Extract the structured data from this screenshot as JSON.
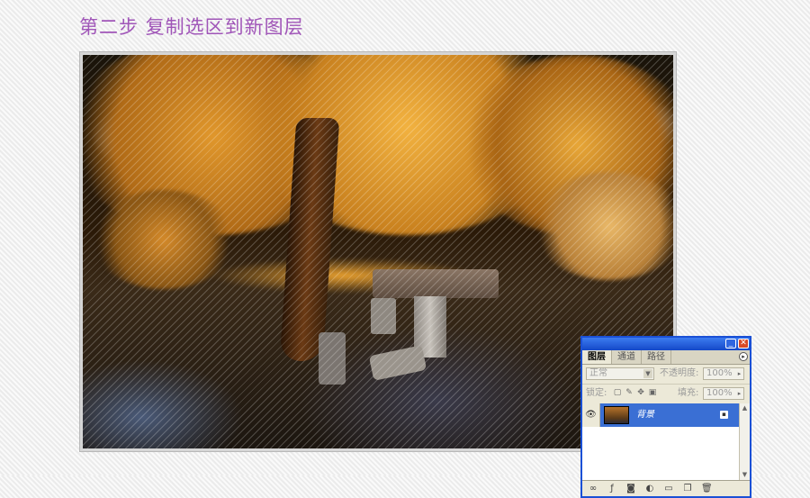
{
  "title": "第二步 复制选区到新图层",
  "layers_panel": {
    "tabs": [
      "图层",
      "通道",
      "路径"
    ],
    "active_tab": "图层",
    "blend_mode": "正常",
    "opacity_label": "不透明度:",
    "opacity_value": "100%",
    "lock_label": "锁定:",
    "fill_label": "填充:",
    "fill_value": "100%",
    "layers": [
      {
        "name": "背景",
        "visible": true,
        "locked": true,
        "selected": true
      }
    ],
    "bottom_tools": [
      "link-icon",
      "layer-style-icon",
      "mask-icon",
      "adjustment-layer-icon",
      "folder-icon",
      "new-layer-icon",
      "trash-icon"
    ]
  },
  "colors": {
    "title": "#a055b8",
    "palette_border": "#1a50d6",
    "selected_layer": "#3a6fd4"
  }
}
